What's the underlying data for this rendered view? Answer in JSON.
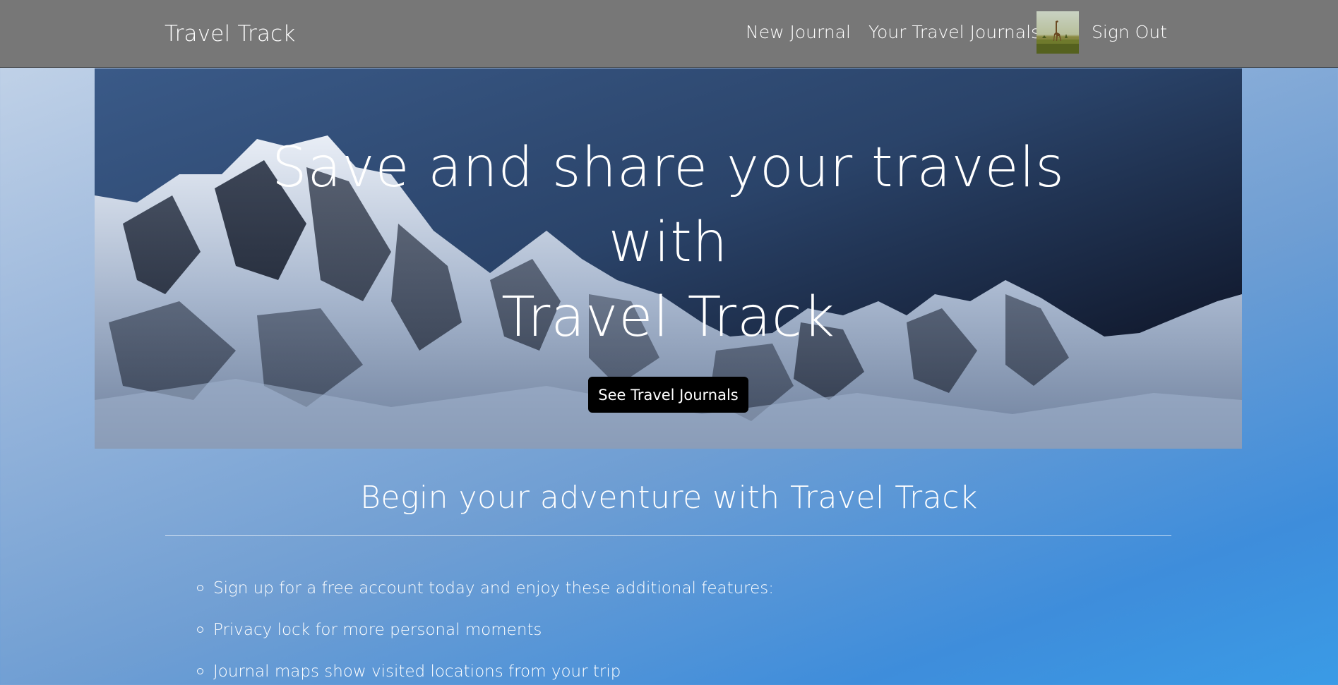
{
  "navbar": {
    "brand": "Travel Track",
    "links": {
      "new_journal": "New Journal",
      "your_journals": "Your Travel Journals",
      "sign_out": "Sign Out"
    },
    "avatar_icon": "giraffe-photo"
  },
  "hero": {
    "title_lines": [
      "Save and share your travels",
      "with",
      "Travel Track"
    ],
    "button_label": "See Travel Journals"
  },
  "section": {
    "title": "Begin your adventure with Travel Track",
    "features": [
      "Sign up for a free account today and enjoy these additional features:",
      "Privacy lock for more personal moments",
      "Journal maps show visited locations from your trip"
    ]
  },
  "colors": {
    "navbar_bg": "#777777",
    "button_bg": "#000000",
    "text": "#ffffff",
    "gradient_start": "#c8d7ea",
    "gradient_end": "#3a9be6"
  }
}
